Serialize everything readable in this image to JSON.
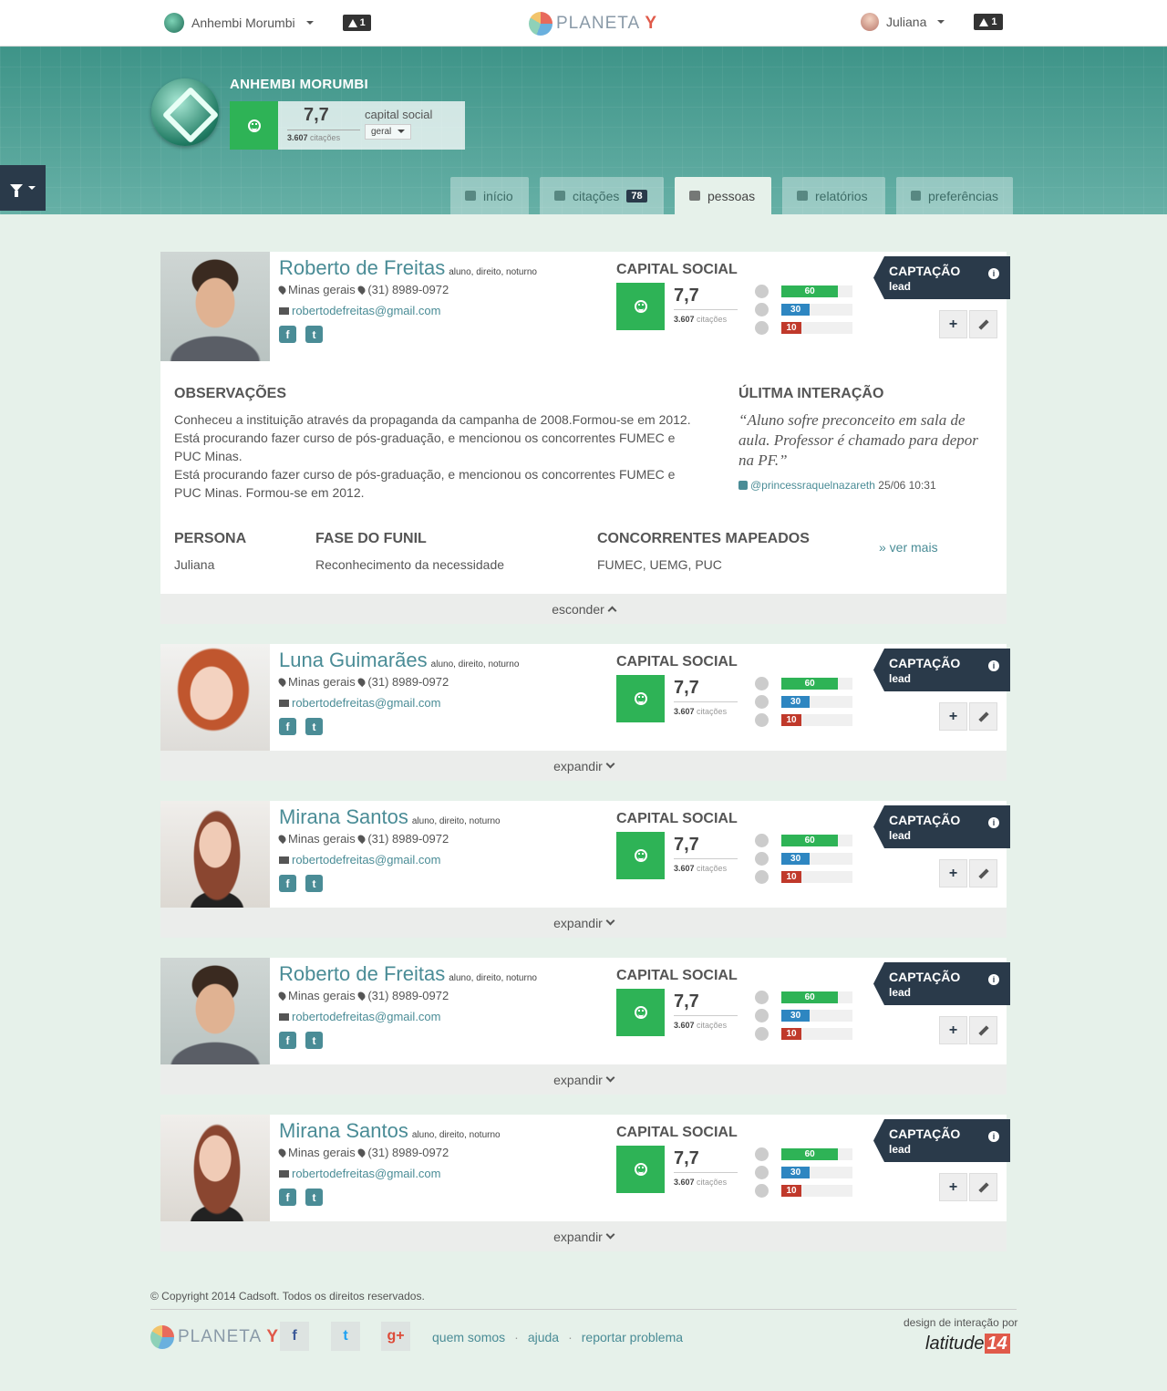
{
  "topbar": {
    "institution": "Anhembi Morumbi",
    "alert_count": "1",
    "brand": "PLANETA",
    "brand_mark": "Y",
    "user": "Juliana",
    "user_alert_count": "1"
  },
  "hero": {
    "name": "ANHEMBI MORUMBI",
    "score": "7,7",
    "citations": "3.607",
    "citations_label": "citações",
    "cs_label": "capital social",
    "scope": "geral"
  },
  "tabs": [
    {
      "label": "início"
    },
    {
      "label": "citações",
      "count": "78"
    },
    {
      "label": "pessoas"
    },
    {
      "label": "relatórios"
    },
    {
      "label": "preferências"
    }
  ],
  "card_common": {
    "tags": "aluno, direito, noturno",
    "location": "Minas gerais",
    "phone": "(31) 8989-0972",
    "email": "robertodefreitas@gmail.com",
    "cs_title": "CAPITAL SOCIAL",
    "score": "7,7",
    "citations": "3.607",
    "citations_label": "citações",
    "positive": 60,
    "neutral": 30,
    "negative": 10,
    "cap_title": "CAPTAÇÃO",
    "cap_sub": "lead",
    "expand": "expandir",
    "collapse": "esconder"
  },
  "people": [
    {
      "name": "Roberto de Freitas"
    },
    {
      "name": "Luna Guimarães"
    },
    {
      "name": "Mirana Santos"
    },
    {
      "name": "Roberto de Freitas"
    },
    {
      "name": "Mirana Santos"
    }
  ],
  "detail": {
    "obs_title": "OBSERVAÇÕES",
    "obs_lines": [
      "Conheceu a instituição através da propaganda da campanha de 2008.Formou-se em 2012.",
      "Está procurando fazer curso de pós-graduação, e mencionou os concorrentes FUMEC e PUC Minas.",
      "Está procurando fazer curso de pós-graduação, e mencionou os concorrentes FUMEC e PUC Minas. Formou-se em 2012."
    ],
    "last_title": "ÚLITMA INTERAÇÃO",
    "quote": "“Aluno sofre preconceito em sala de aula. Professor é chamado para depor na PF.”",
    "quote_user": "@princessraquelnazareth",
    "quote_date": "25/06 10:31",
    "persona_title": "PERSONA",
    "persona": "Juliana",
    "funnel_title": "FASE DO FUNIL",
    "funnel": "Reconhecimento da necessidade",
    "comp_title": "CONCORRENTES MAPEADOS",
    "comp": "FUMEC, UEMG, PUC",
    "more": "» ver mais"
  },
  "footer": {
    "copyright": "© Copyright 2014 Cadsoft. Todos os direitos reservados.",
    "brand": "PLANETA",
    "brand_mark": "Y",
    "links": [
      "quem somos",
      "ajuda",
      "reportar problema"
    ],
    "design_by": "design de interação por",
    "latitude": "latitude",
    "latitude_num": "14"
  },
  "colors": {
    "accent": "#4a8c96",
    "positive": "#2eb356",
    "neutral": "#2e86c1",
    "negative": "#c0392b",
    "dark": "#2a3a4a"
  }
}
